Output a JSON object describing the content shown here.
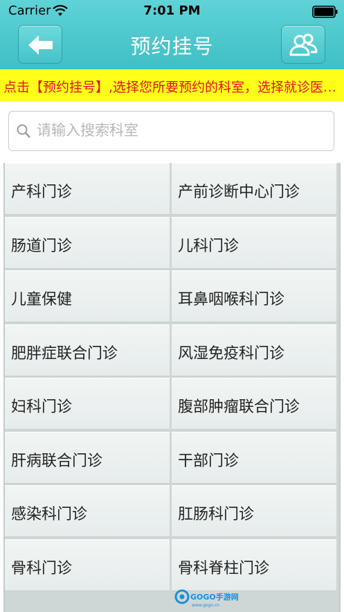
{
  "status_bar": {
    "carrier": "Carrier",
    "time": "7:01 PM"
  },
  "nav": {
    "title": "预约挂号",
    "back_icon": "arrow-left-icon",
    "user_icon": "users-icon",
    "accent_color": "#4cc8cc"
  },
  "notice": {
    "text": "点击【预约挂号】,选择您所要预约的科室，选择就诊医生及时间",
    "text_color": "#e0122a",
    "background": "#ffff1a"
  },
  "search": {
    "placeholder": "请输入搜索科室",
    "value": ""
  },
  "departments": [
    "产科门诊",
    "产前诊断中心门诊",
    "肠道门诊",
    "儿科门诊",
    "儿童保健",
    "耳鼻咽喉科门诊",
    "肥胖症联合门诊",
    "风湿免疫科门诊",
    "妇科门诊",
    "腹部肿瘤联合门诊",
    "肝病联合门诊",
    "干部门诊",
    "感染科门诊",
    "肛肠科门诊",
    "骨科门诊",
    "骨科脊柱门诊"
  ],
  "watermark": {
    "brand": "GOGO手游网",
    "url": "www.gogo.cn"
  }
}
